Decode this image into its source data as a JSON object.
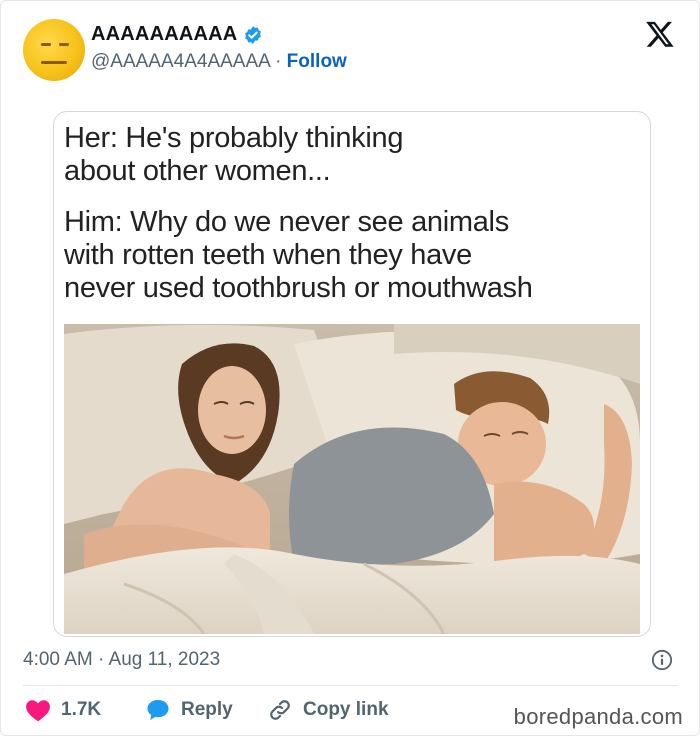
{
  "user": {
    "display_name": "AAAAAAAAAA",
    "handle": "@AAAAA4A4AAAAA",
    "separator": "·",
    "follow_label": "Follow",
    "avatar_icon": "yellow-face-avatar",
    "verified_icon": "verified-badge-icon",
    "verified_color": "#1d9bf0"
  },
  "meme": {
    "line_her": [
      "Her: He's probably thinking",
      "about other women..."
    ],
    "line_him": [
      "Him: Why do we never see animals",
      "with rotten teeth when they have",
      "never used toothbrush or mouthwash"
    ],
    "photo_icon": "couple-in-bed-photo"
  },
  "meta": {
    "timestamp": "4:00 AM · Aug 11, 2023",
    "info_icon": "info-icon"
  },
  "actions": {
    "like_count": "1.7K",
    "like_icon": "heart-icon",
    "like_color": "#f91880",
    "reply_label": "Reply",
    "reply_icon": "speech-bubble-icon",
    "reply_color": "#1d9bf0",
    "copy_label": "Copy link",
    "copy_icon": "link-icon"
  },
  "watermark": "boredpanda.com",
  "brand_icon": "x-logo-icon"
}
